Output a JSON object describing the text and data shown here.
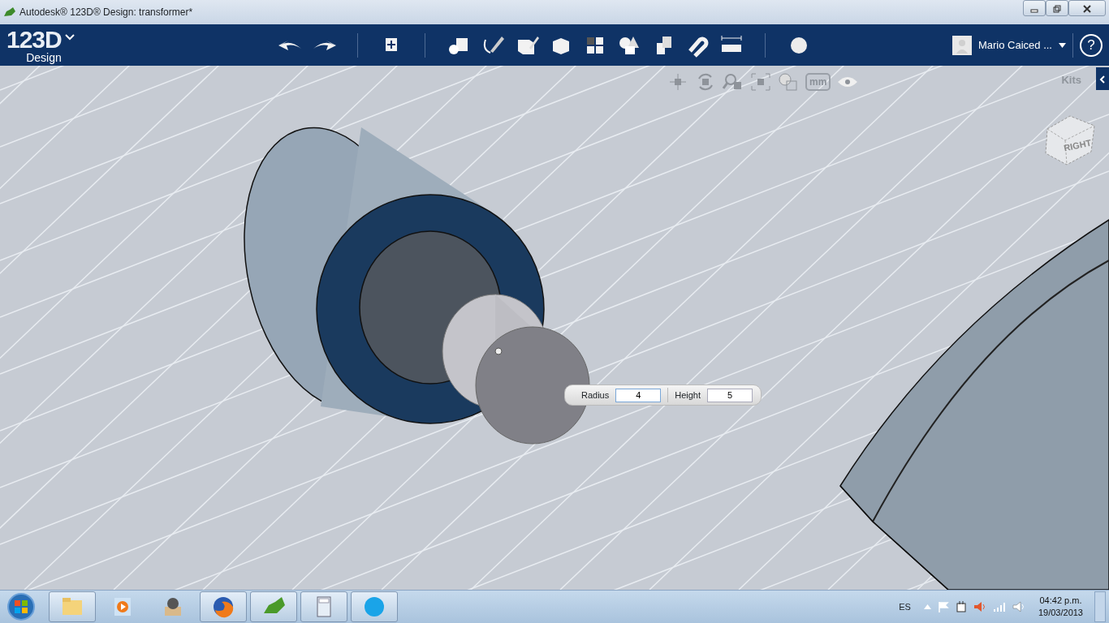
{
  "window": {
    "title": "Autodesk® 123D® Design: transformer*"
  },
  "toolbar": {
    "logo": "123D",
    "logo_sub": "Design",
    "user": "Mario Caiced ...",
    "help": "?"
  },
  "viewport": {
    "kits_label": "Kits",
    "units": "mm",
    "view_cube_face": "RIGHT"
  },
  "dimension_input": {
    "fields": [
      {
        "label": "Radius",
        "value": "4",
        "focused": true
      },
      {
        "label": "Height",
        "value": "5",
        "focused": false
      }
    ]
  },
  "taskbar": {
    "apps": [
      {
        "kind": "explorer",
        "running": true
      },
      {
        "kind": "media",
        "running": false
      },
      {
        "kind": "gadget",
        "running": false
      },
      {
        "kind": "browser",
        "running": true
      },
      {
        "kind": "design",
        "running": true
      },
      {
        "kind": "calculator",
        "running": true
      },
      {
        "kind": "chat",
        "running": true
      }
    ],
    "language": "ES",
    "time": "04:42 p.m.",
    "date": "19/03/2013"
  }
}
